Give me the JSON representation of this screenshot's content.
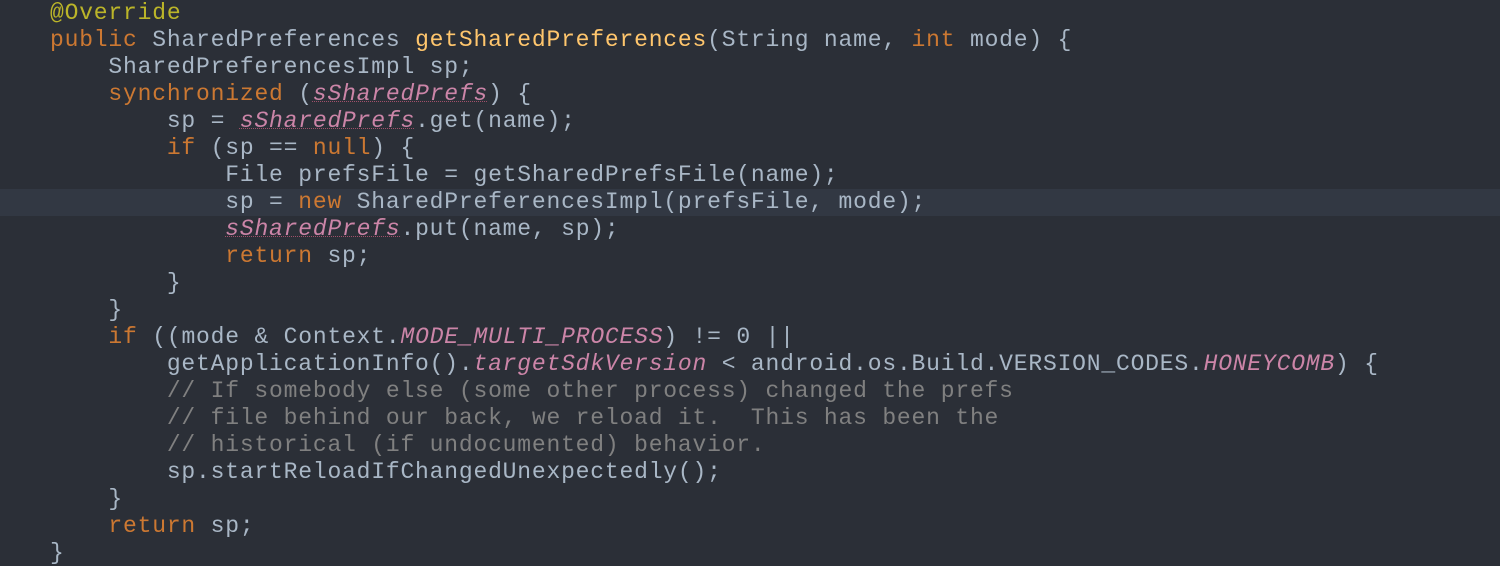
{
  "code": {
    "l1": {
      "t1": "@Override"
    },
    "l2": {
      "t1": "public ",
      "t2": "SharedPreferences ",
      "t3": "getSharedPreferences",
      "t4": "(String name, ",
      "t5": "int ",
      "t6": "mode) {"
    },
    "l3": {
      "t1": "    SharedPreferencesImpl sp;"
    },
    "l4": {
      "t1": "    ",
      "t2": "synchronized ",
      "t3": "(",
      "t4": "sSharedPrefs",
      "t5": ") {"
    },
    "l5": {
      "t1": "        sp = ",
      "t2": "sSharedPrefs",
      "t3": ".get(name);"
    },
    "l6": {
      "t1": "        ",
      "t2": "if ",
      "t3": "(sp == ",
      "t4": "null",
      "t5": ") {"
    },
    "l7": {
      "t1": "            File prefsFile = getSharedPrefsFile(name);"
    },
    "l8": {
      "t1": "            sp = ",
      "t2": "new ",
      "t3": "SharedPreferencesImpl(prefsFile, mode);"
    },
    "l9": {
      "t1": "            ",
      "t2": "sSharedPrefs",
      "t3": ".put(name, sp);"
    },
    "l10": {
      "t1": "            ",
      "t2": "return ",
      "t3": "sp;"
    },
    "l11": {
      "t1": "        }"
    },
    "l12": {
      "t1": "    }"
    },
    "l13": {
      "t1": "    ",
      "t2": "if ",
      "t3": "((mode & Context.",
      "t4": "MODE_MULTI_PROCESS",
      "t5": ") != ",
      "t6": "0 ",
      "t7": "||"
    },
    "l14": {
      "t1": "        getApplicationInfo().",
      "t2": "targetSdkVersion ",
      "t3": "< android.os.Build.VERSION_CODES.",
      "t4": "HONEYCOMB",
      "t5": ") {"
    },
    "l15": {
      "t1": "        // If somebody else (some other process) changed the prefs"
    },
    "l16": {
      "t1": "        // file behind our back, we reload it.  This has been the"
    },
    "l17": {
      "t1": "        // historical (if undocumented) behavior."
    },
    "l18": {
      "t1": "        sp.startReloadIfChangedUnexpectedly();"
    },
    "l19": {
      "t1": "    }"
    },
    "l20": {
      "t1": "    ",
      "t2": "return ",
      "t3": "sp;"
    },
    "l21": {
      "t1": "}"
    }
  }
}
